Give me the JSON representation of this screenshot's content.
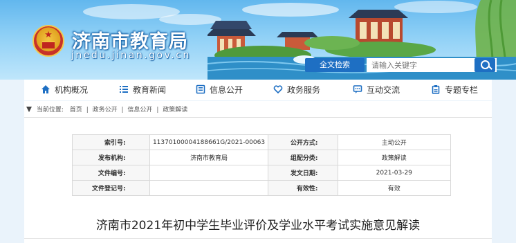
{
  "header": {
    "site_title": "济南市教育局",
    "site_domain": "jnedu.jinan.gov.cn",
    "search": {
      "scope_label": "全文检索",
      "placeholder": "请输入关键字"
    }
  },
  "nav": [
    {
      "label": "机构概况",
      "icon": "home-icon"
    },
    {
      "label": "教育新闻",
      "icon": "list-icon"
    },
    {
      "label": "信息公开",
      "icon": "document-icon"
    },
    {
      "label": "政务服务",
      "icon": "heart-icon"
    },
    {
      "label": "互动交流",
      "icon": "chat-icon"
    },
    {
      "label": "专题专栏",
      "icon": "clipboard-icon"
    }
  ],
  "breadcrumb": {
    "prefix": "当前位置:",
    "items": [
      "首页",
      "政务公开",
      "信息公开",
      "政策解读"
    ]
  },
  "meta": {
    "rows": [
      {
        "k1": "索引号:",
        "v1": "11370100004188661G/2021-00063",
        "k2": "公开方式:",
        "v2": "主动公开"
      },
      {
        "k1": "发布机构:",
        "v1": "济南市教育局",
        "k2": "组配分类:",
        "v2": "政策解读"
      },
      {
        "k1": "文件编号:",
        "v1": "",
        "k2": "发文日期:",
        "v2": "2021-03-29"
      },
      {
        "k1": "文件登记号:",
        "v1": "",
        "k2": "有效性:",
        "v2": "有效"
      }
    ]
  },
  "article": {
    "title": "济南市2021年初中学生毕业评价及学业水平考试实施意见解读"
  }
}
